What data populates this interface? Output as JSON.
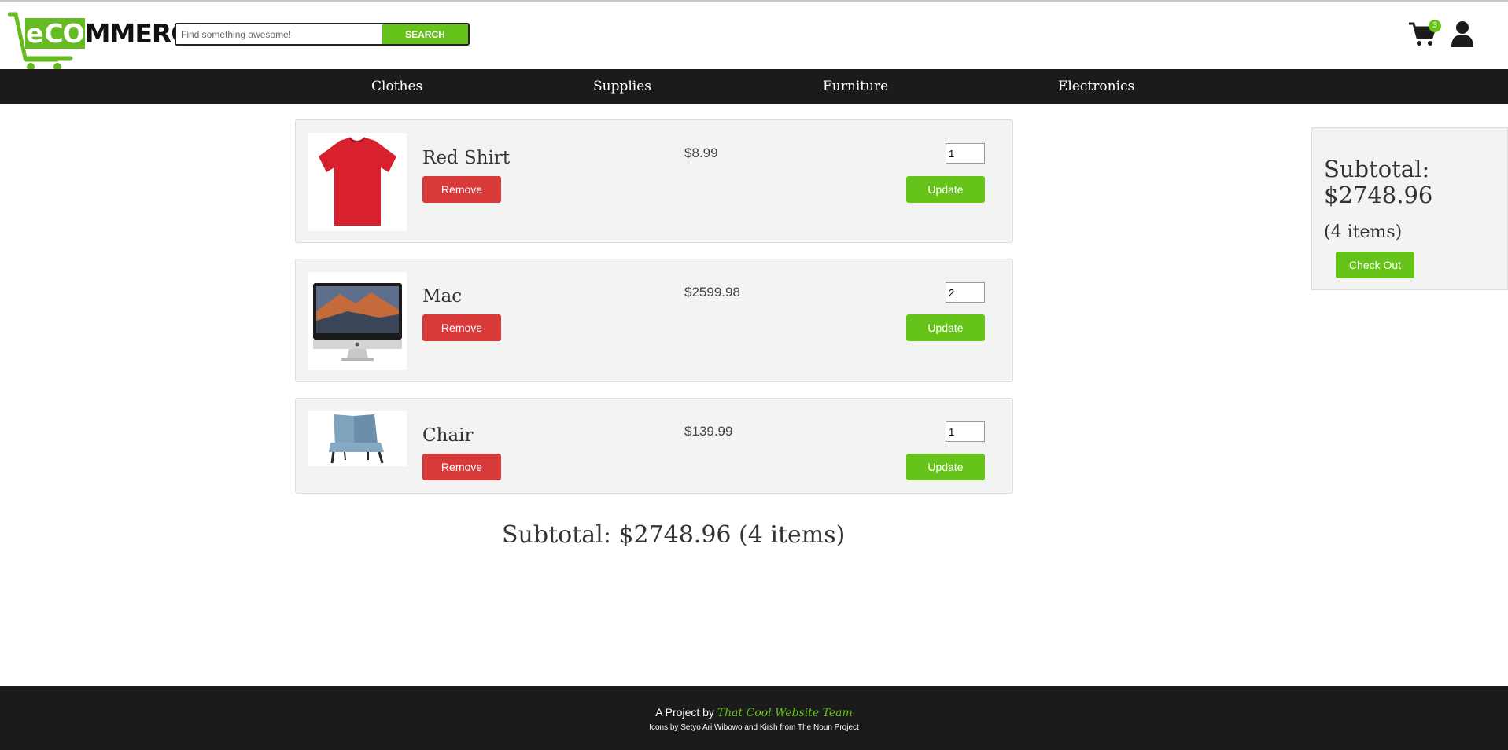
{
  "brand": {
    "logo_text_e": "e",
    "logo_text_co": "CO",
    "logo_text_rest": "MMERCE",
    "accent": "#66c31a"
  },
  "search": {
    "placeholder": "Find something awesome!",
    "button_label": "SEARCH"
  },
  "header": {
    "cart_count": "3",
    "cart_icon": "cart-icon",
    "user_icon": "user-icon"
  },
  "nav": {
    "items": [
      "Clothes",
      "Supplies",
      "Furniture",
      "Electronics"
    ]
  },
  "cart": {
    "items": [
      {
        "name": "Red Shirt",
        "price": "$8.99",
        "quantity": "1",
        "remove_label": "Remove",
        "update_label": "Update",
        "image": "red-shirt-image"
      },
      {
        "name": "Mac",
        "price": "$2599.98",
        "quantity": "2",
        "remove_label": "Remove",
        "update_label": "Update",
        "image": "imac-image"
      },
      {
        "name": "Chair",
        "price": "$139.99",
        "quantity": "1",
        "remove_label": "Remove",
        "update_label": "Update",
        "image": "chair-image"
      }
    ],
    "subtotal_text": "Subtotal: $2748.96 (4 items)"
  },
  "summary": {
    "subtotal_label": "Subtotal:",
    "subtotal_value": "$2748.96",
    "items_text": "(4 items)",
    "checkout_label": "Check Out"
  },
  "footer": {
    "project_prefix": "A Project by",
    "team_name": "That Cool Website Team",
    "credits": "Icons by Setyo Ari Wibowo and Kirsh from The Noun Project"
  },
  "colors": {
    "nav_bg": "#1b1b1b",
    "remove": "#d83a3a",
    "green": "#66c31a"
  }
}
